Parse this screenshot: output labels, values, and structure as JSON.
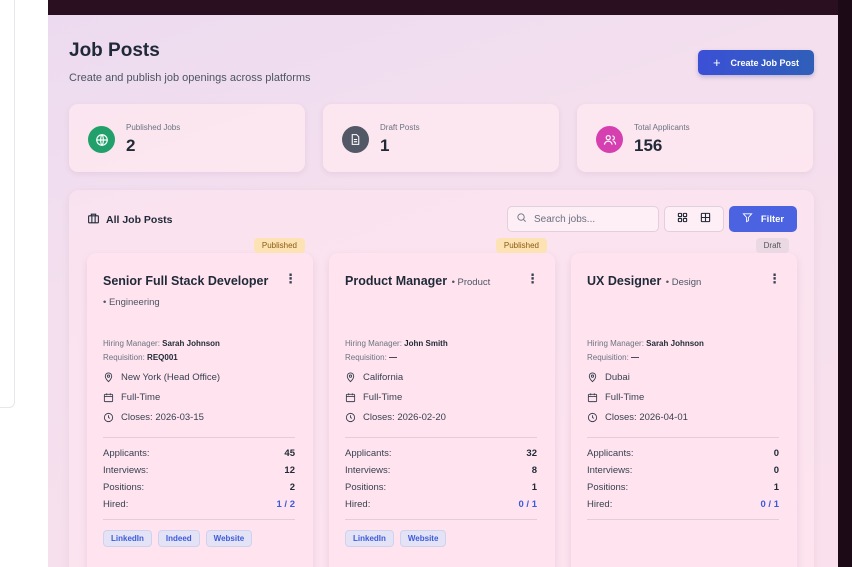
{
  "header": {
    "title": "Job Posts",
    "subtitle": "Create and publish job openings across platforms",
    "create_label": "Create Job Post"
  },
  "stats": [
    {
      "label": "Published Jobs",
      "value": "2",
      "icon": "globe-icon",
      "color": "#22a06b"
    },
    {
      "label": "Draft Posts",
      "value": "1",
      "icon": "document-icon",
      "color": "#525866"
    },
    {
      "label": "Total Applicants",
      "value": "156",
      "icon": "users-icon",
      "color": "#d63fb0"
    }
  ],
  "list": {
    "title": "All Job Posts",
    "search_placeholder": "Search jobs...",
    "filter_label": "Filter"
  },
  "labels": {
    "hiring_manager": "Hiring Manager:",
    "requisition": "Requisition:",
    "applicants": "Applicants:",
    "interviews": "Interviews:",
    "positions": "Positions:",
    "hired": "Hired:"
  },
  "jobs": [
    {
      "status": "Published",
      "title": "Senior Full Stack Developer",
      "department": "• Engineering",
      "manager": "Sarah Johnson",
      "requisition": "REQ001",
      "location": "New York (Head Office)",
      "type": "Full-Time",
      "closes": "Closes: 2026-03-15",
      "applicants": "45",
      "interviews": "12",
      "positions": "2",
      "hired": "1 / 2",
      "platforms": [
        "LinkedIn",
        "Indeed",
        "Website"
      ]
    },
    {
      "status": "Published",
      "title": "Product Manager",
      "department": "• Product",
      "manager": "John Smith",
      "requisition": "—",
      "location": "California",
      "type": "Full-Time",
      "closes": "Closes: 2026-02-20",
      "applicants": "32",
      "interviews": "8",
      "positions": "1",
      "hired": "0 / 1",
      "platforms": [
        "LinkedIn",
        "Website"
      ]
    },
    {
      "status": "Draft",
      "title": "UX Designer",
      "department": "• Design",
      "manager": "Sarah Johnson",
      "requisition": "—",
      "location": "Dubai",
      "type": "Full-Time",
      "closes": "Closes: 2026-04-01",
      "applicants": "0",
      "interviews": "0",
      "positions": "1",
      "hired": "0 / 1",
      "platforms": []
    }
  ]
}
